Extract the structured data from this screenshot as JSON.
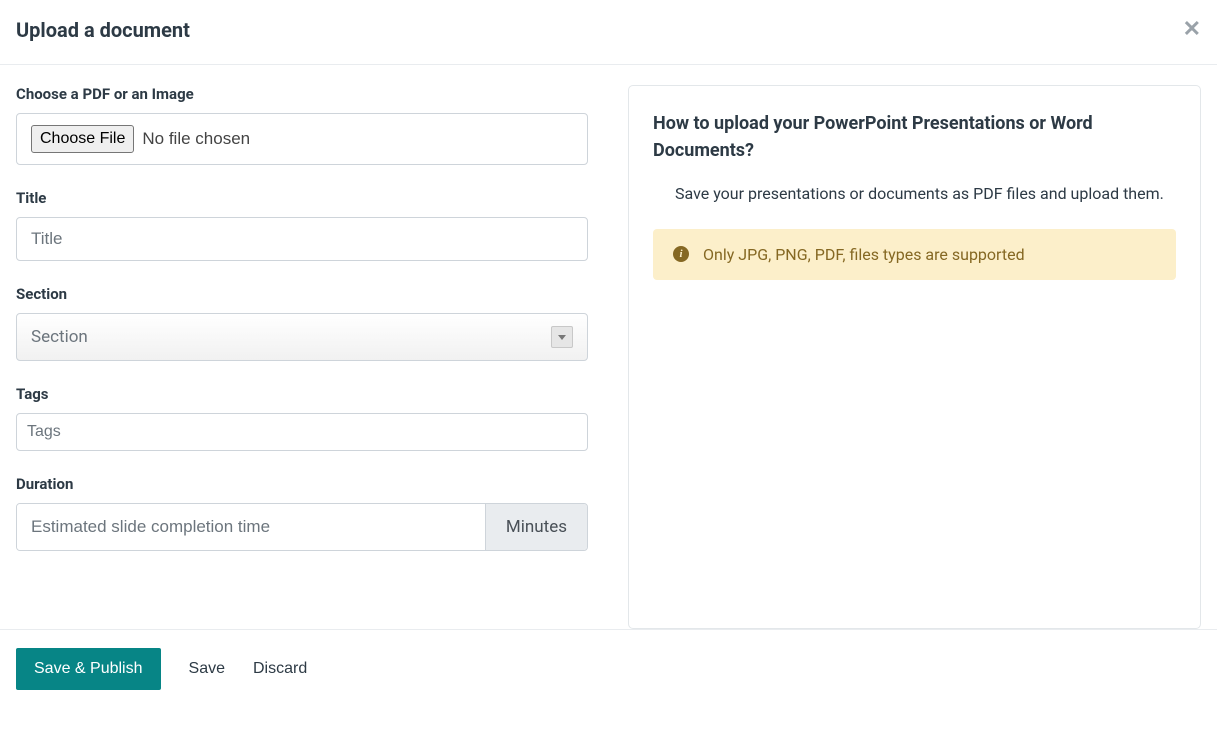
{
  "header": {
    "title": "Upload a document",
    "close_icon_label": "close"
  },
  "form": {
    "file": {
      "label": "Choose a PDF or an Image",
      "button": "Choose File",
      "status": "No file chosen"
    },
    "title": {
      "label": "Title",
      "placeholder": "Title",
      "value": ""
    },
    "section": {
      "label": "Section",
      "placeholder": "Section",
      "value": ""
    },
    "tags": {
      "label": "Tags",
      "placeholder": "Tags",
      "value": ""
    },
    "duration": {
      "label": "Duration",
      "placeholder": "Estimated slide completion time",
      "unit": "Minutes",
      "value": ""
    }
  },
  "help": {
    "title": "How to upload your PowerPoint Presentations or Word Documents?",
    "body": "Save your presentations or documents as PDF files and upload them.",
    "alert": "Only JPG, PNG, PDF, files types are supported"
  },
  "footer": {
    "save_publish": "Save & Publish",
    "save": "Save",
    "discard": "Discard"
  }
}
